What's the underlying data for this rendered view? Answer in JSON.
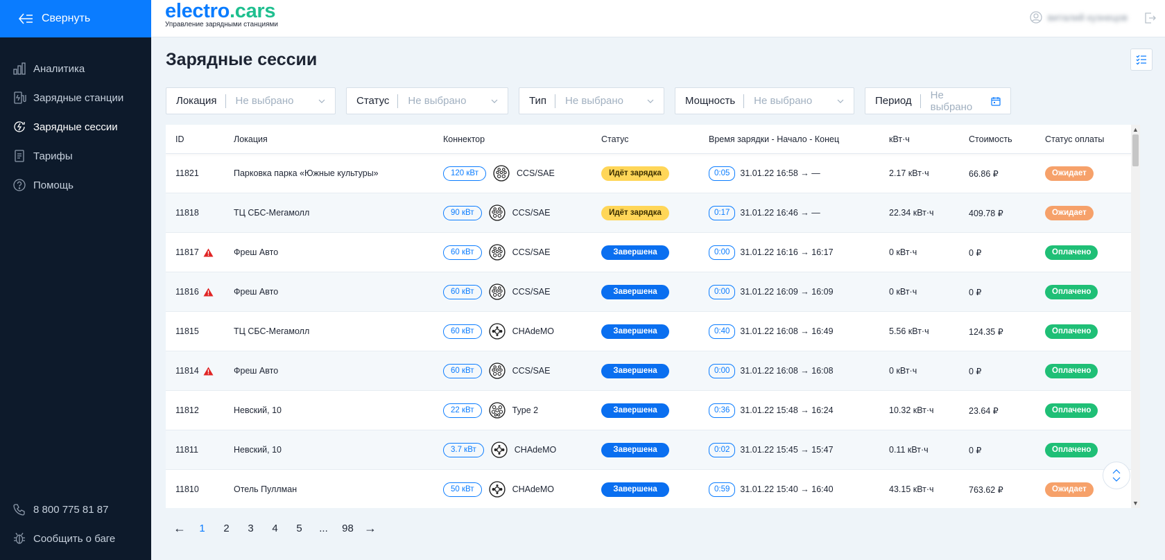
{
  "sidebar": {
    "collapse_label": "Свернуть",
    "items": [
      {
        "label": "Аналитика",
        "icon": "chart-icon"
      },
      {
        "label": "Зарядные станции",
        "icon": "station-icon"
      },
      {
        "label": "Зарядные сессии",
        "icon": "session-icon",
        "active": true
      },
      {
        "label": "Тарифы",
        "icon": "tariff-icon"
      },
      {
        "label": "Помощь",
        "icon": "help-icon"
      }
    ],
    "phone": "8 800 775 81 87",
    "report_bug": "Сообщить о баге"
  },
  "header": {
    "logo_part1": "electro",
    "logo_part2": ".cars",
    "logo_subtitle": "Управление зарядными станциями",
    "user_name": "виталий кузнецов"
  },
  "page_title": "Зарядные сессии",
  "filters": [
    {
      "label": "Локация",
      "value": "Не выбрано"
    },
    {
      "label": "Статус",
      "value": "Не выбрано"
    },
    {
      "label": "Тип",
      "value": "Не выбрано"
    },
    {
      "label": "Мощность",
      "value": "Не выбрано"
    },
    {
      "label": "Период",
      "value": "Не выбрано"
    }
  ],
  "table": {
    "columns": [
      "ID",
      "Локация",
      "Коннектор",
      "Статус",
      "Время зарядки - Начало - Конец",
      "кВт·ч",
      "Стоимость",
      "Статус оплаты"
    ],
    "rows": [
      {
        "id": "11821",
        "warn": false,
        "location": "Парковка парка «Южные культуры»",
        "power": "120 кВт",
        "connector": "CCS/SAE",
        "status": "Идёт зарядка",
        "status_kind": "charging",
        "duration": "0:05",
        "time": "31.01.22 16:58 → —",
        "kwh": "2.17 кВт·ч",
        "cost": "66.86 ₽",
        "pay": "Ожидает",
        "pay_kind": "wait"
      },
      {
        "id": "11818",
        "warn": false,
        "location": "ТЦ СБС-Мегамолл",
        "power": "90 кВт",
        "connector": "CCS/SAE",
        "status": "Идёт зарядка",
        "status_kind": "charging",
        "duration": "0:17",
        "time": "31.01.22 16:46 → —",
        "kwh": "22.34 кВт·ч",
        "cost": "409.78 ₽",
        "pay": "Ожидает",
        "pay_kind": "wait"
      },
      {
        "id": "11817",
        "warn": true,
        "location": "Фреш Авто",
        "power": "60 кВт",
        "connector": "CCS/SAE",
        "status": "Завершена",
        "status_kind": "done",
        "duration": "0:00",
        "time": "31.01.22 16:16 → 16:17",
        "kwh": "0 кВт·ч",
        "cost": "0 ₽",
        "pay": "Оплачено",
        "pay_kind": "paid"
      },
      {
        "id": "11816",
        "warn": true,
        "location": "Фреш Авто",
        "power": "60 кВт",
        "connector": "CCS/SAE",
        "status": "Завершена",
        "status_kind": "done",
        "duration": "0:00",
        "time": "31.01.22 16:09 → 16:09",
        "kwh": "0 кВт·ч",
        "cost": "0 ₽",
        "pay": "Оплачено",
        "pay_kind": "paid"
      },
      {
        "id": "11815",
        "warn": false,
        "location": "ТЦ СБС-Мегамолл",
        "power": "60 кВт",
        "connector": "CHAdeMO",
        "status": "Завершена",
        "status_kind": "done",
        "duration": "0:40",
        "time": "31.01.22 16:08 → 16:49",
        "kwh": "5.56 кВт·ч",
        "cost": "124.35 ₽",
        "pay": "Оплачено",
        "pay_kind": "paid"
      },
      {
        "id": "11814",
        "warn": true,
        "location": "Фреш Авто",
        "power": "60 кВт",
        "connector": "CCS/SAE",
        "status": "Завершена",
        "status_kind": "done",
        "duration": "0:00",
        "time": "31.01.22 16:08 → 16:08",
        "kwh": "0 кВт·ч",
        "cost": "0 ₽",
        "pay": "Оплачено",
        "pay_kind": "paid"
      },
      {
        "id": "11812",
        "warn": false,
        "location": "Невский, 10",
        "power": "22 кВт",
        "connector": "Type 2",
        "status": "Завершена",
        "status_kind": "done",
        "duration": "0:36",
        "time": "31.01.22 15:48 → 16:24",
        "kwh": "10.32 кВт·ч",
        "cost": "23.64 ₽",
        "pay": "Оплачено",
        "pay_kind": "paid"
      },
      {
        "id": "11811",
        "warn": false,
        "location": "Невский, 10",
        "power": "3.7 кВт",
        "connector": "CHAdeMO",
        "status": "Завершена",
        "status_kind": "done",
        "duration": "0:02",
        "time": "31.01.22 15:45 → 15:47",
        "kwh": "0.11 кВт·ч",
        "cost": "0 ₽",
        "pay": "Оплачено",
        "pay_kind": "paid"
      },
      {
        "id": "11810",
        "warn": false,
        "location": "Отель Пуллман",
        "power": "50 кВт",
        "connector": "CHAdeMO",
        "status": "Завершена",
        "status_kind": "done",
        "duration": "0:59",
        "time": "31.01.22 15:40 → 16:40",
        "kwh": "43.15 кВт·ч",
        "cost": "763.62 ₽",
        "pay": "Ожидает",
        "pay_kind": "wait"
      }
    ]
  },
  "pagination": {
    "pages": [
      "1",
      "2",
      "3",
      "4",
      "5",
      "...",
      "98"
    ],
    "current": "1",
    "prev": "←",
    "next": "→"
  },
  "colors": {
    "accent": "#0a7cff",
    "sidebar": "#0d1a2b",
    "charging": "#ffd658",
    "done": "#0a6ff0",
    "paid": "#1fbf76",
    "wait": "#f6a16a",
    "warning": "#e02424"
  }
}
